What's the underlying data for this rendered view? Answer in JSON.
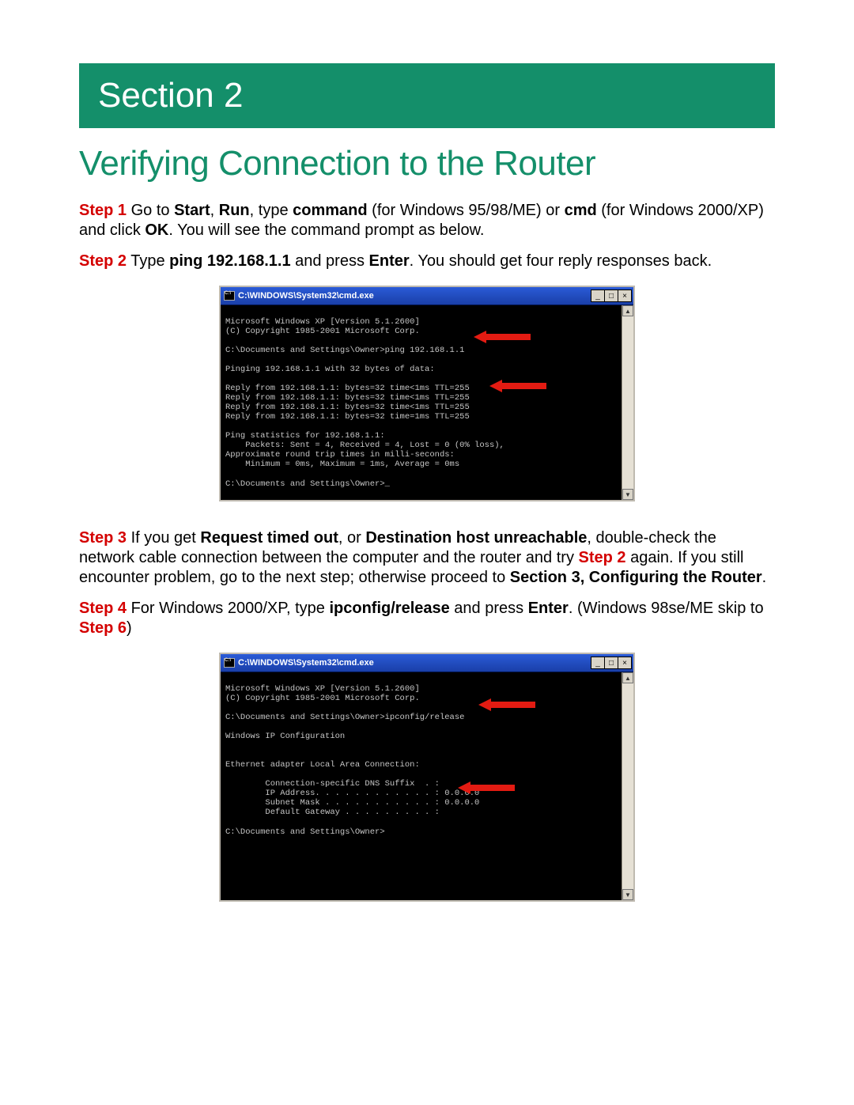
{
  "section_banner": "Section 2",
  "title": "Verifying Connection to the Router",
  "steps": {
    "s1": {
      "label": "Step 1",
      "pre": " Go to ",
      "start": "Start",
      "comma1": ", ",
      "run": "Run",
      "t1": ", type ",
      "command": "command",
      "t2": " (for Windows 95/98/ME) or ",
      "cmd": "cmd",
      "t3": " (for Windows 2000/XP) and click ",
      "ok": "OK",
      "t4": ". You will see the command prompt as below."
    },
    "s2": {
      "label": "Step 2",
      "t1": " Type ",
      "ping": "ping 192.168.1.1",
      "t2": " and press ",
      "enter": "Enter",
      "t3": ". You should get four reply responses back."
    },
    "s3": {
      "label": "Step 3",
      "t1": " If you get ",
      "rto": "Request timed out",
      "t2": ", or ",
      "dhu": "Destination host unreachable",
      "t3": ", double-check the network cable connection between the computer and the router and try ",
      "s2ref": "Step 2",
      "t4": " again. If you still encounter problem, go to the next step; otherwise proceed to ",
      "sec3": "Section 3, Configuring the Router",
      "t5": "."
    },
    "s4": {
      "label": "Step 4",
      "t1": " For Windows 2000/XP, type ",
      "ipr": "ipconfig/release",
      "t2": " and press ",
      "enter": "Enter",
      "t3": ". (Windows 98se/ME skip to ",
      "s6ref": "Step 6",
      "t4": ")"
    }
  },
  "cmd1": {
    "title": "C:\\WINDOWS\\System32\\cmd.exe",
    "lines": "Microsoft Windows XP [Version 5.1.2600]\n(C) Copyright 1985-2001 Microsoft Corp.\n\nC:\\Documents and Settings\\Owner>ping 192.168.1.1\n\nPinging 192.168.1.1 with 32 bytes of data:\n\nReply from 192.168.1.1: bytes=32 time<1ms TTL=255\nReply from 192.168.1.1: bytes=32 time<1ms TTL=255\nReply from 192.168.1.1: bytes=32 time<1ms TTL=255\nReply from 192.168.1.1: bytes=32 time=1ms TTL=255\n\nPing statistics for 192.168.1.1:\n    Packets: Sent = 4, Received = 4, Lost = 0 (0% loss),\nApproximate round trip times in milli-seconds:\n    Minimum = 0ms, Maximum = 1ms, Average = 0ms\n\nC:\\Documents and Settings\\Owner>_"
  },
  "cmd2": {
    "title": "C:\\WINDOWS\\System32\\cmd.exe",
    "lines": "Microsoft Windows XP [Version 5.1.2600]\n(C) Copyright 1985-2001 Microsoft Corp.\n\nC:\\Documents and Settings\\Owner>ipconfig/release\n\nWindows IP Configuration\n\n\nEthernet adapter Local Area Connection:\n\n        Connection-specific DNS Suffix  . :\n        IP Address. . . . . . . . . . . . : 0.0.0.0\n        Subnet Mask . . . . . . . . . . . : 0.0.0.0\n        Default Gateway . . . . . . . . . :\n\nC:\\Documents and Settings\\Owner>"
  },
  "win_controls": {
    "min": "_",
    "max": "□",
    "close": "×",
    "up": "▲",
    "down": "▼"
  }
}
